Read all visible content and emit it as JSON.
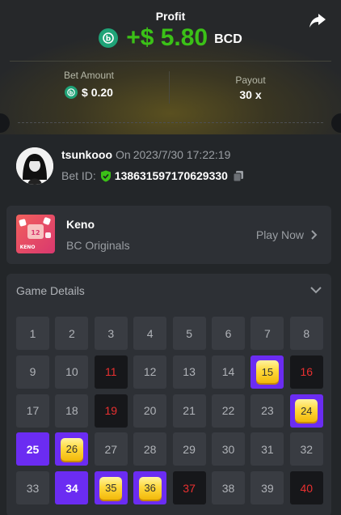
{
  "profit": {
    "label": "Profit",
    "value": "+$ 5.80",
    "currency": "BCD"
  },
  "bet": {
    "label": "Bet Amount",
    "value": "$ 0.20"
  },
  "payout": {
    "label": "Payout",
    "value": "30 x"
  },
  "user": {
    "name": "tsunkooo",
    "on": "On",
    "datetime": "2023/7/30 17:22:19",
    "bet_id_label": "Bet ID:",
    "bet_id": "138631597170629330"
  },
  "game": {
    "name": "Keno",
    "provider": "BC Originals",
    "play_label": "Play Now",
    "thumb_text": "KENO",
    "thumb_ball": "12"
  },
  "details": {
    "title": "Game Details"
  },
  "grid": {
    "numbers": [
      "1",
      "2",
      "3",
      "4",
      "5",
      "6",
      "7",
      "8",
      "9",
      "10",
      "11",
      "12",
      "13",
      "14",
      "15",
      "16",
      "17",
      "18",
      "19",
      "20",
      "21",
      "22",
      "23",
      "24",
      "25",
      "26",
      "27",
      "28",
      "29",
      "30",
      "31",
      "32",
      "33",
      "34",
      "35",
      "36",
      "37",
      "38",
      "39",
      "40"
    ],
    "states": [
      "n",
      "n",
      "n",
      "n",
      "n",
      "n",
      "n",
      "n",
      "n",
      "n",
      "m",
      "n",
      "n",
      "n",
      "h",
      "m",
      "n",
      "n",
      "m",
      "n",
      "n",
      "n",
      "n",
      "h",
      "p",
      "h",
      "n",
      "n",
      "n",
      "n",
      "n",
      "n",
      "n",
      "p",
      "h",
      "h",
      "m",
      "n",
      "n",
      "m"
    ]
  },
  "colors": {
    "profit": "#3bc117",
    "coin": "#1fa377",
    "selected": "#6b2cf2",
    "miss": "#e93030",
    "gem": "#ffd93d"
  }
}
